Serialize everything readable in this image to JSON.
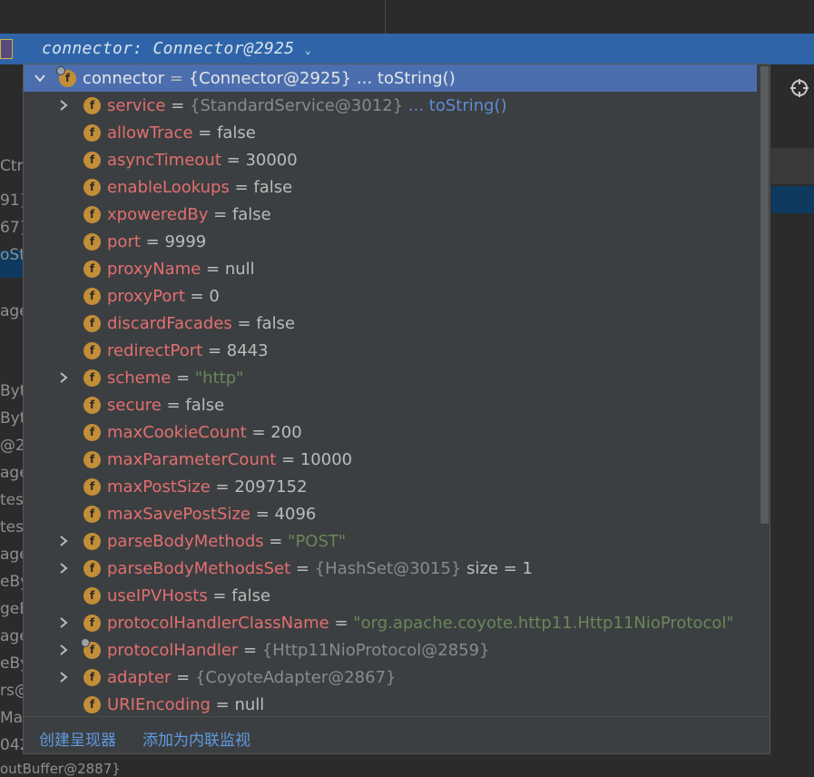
{
  "header": {
    "inline_hint": "connector: Connector@2925",
    "dropdown_icon": "chevron-down-icon"
  },
  "background": {
    "left_fragments": [
      "Ctr",
      "91}",
      "67}",
      "oSt",
      "age",
      "Byte",
      "Byte",
      "@2",
      "age",
      "tes",
      "tes(",
      "age",
      "eBy",
      "geB",
      "age",
      "eBy",
      "rs@",
      "Ma",
      "042"
    ],
    "bottom_fragment": "outBuffer@2887}",
    "target_icon": "crosshair-icon"
  },
  "popup": {
    "root": {
      "name": "connector",
      "value": "{Connector@2925}",
      "tostring": "... toString()"
    },
    "rows": [
      {
        "name": "service",
        "value": "{StandardService@3012}",
        "kind": "obj",
        "expandable": true,
        "tostring": "... toString()"
      },
      {
        "name": "allowTrace",
        "value": "false",
        "kind": "plain",
        "expandable": false
      },
      {
        "name": "asyncTimeout",
        "value": "30000",
        "kind": "plain",
        "expandable": false
      },
      {
        "name": "enableLookups",
        "value": "false",
        "kind": "plain",
        "expandable": false
      },
      {
        "name": "xpoweredBy",
        "value": "false",
        "kind": "plain",
        "expandable": false
      },
      {
        "name": "port",
        "value": "9999",
        "kind": "plain",
        "expandable": false
      },
      {
        "name": "proxyName",
        "value": "null",
        "kind": "plain",
        "expandable": false
      },
      {
        "name": "proxyPort",
        "value": "0",
        "kind": "plain",
        "expandable": false
      },
      {
        "name": "discardFacades",
        "value": "false",
        "kind": "plain",
        "expandable": false
      },
      {
        "name": "redirectPort",
        "value": "8443",
        "kind": "plain",
        "expandable": false
      },
      {
        "name": "scheme",
        "value": "\"http\"",
        "kind": "str",
        "expandable": true
      },
      {
        "name": "secure",
        "value": "false",
        "kind": "plain",
        "expandable": false
      },
      {
        "name": "maxCookieCount",
        "value": "200",
        "kind": "plain",
        "expandable": false
      },
      {
        "name": "maxParameterCount",
        "value": "10000",
        "kind": "plain",
        "expandable": false
      },
      {
        "name": "maxPostSize",
        "value": "2097152",
        "kind": "plain",
        "expandable": false
      },
      {
        "name": "maxSavePostSize",
        "value": "4096",
        "kind": "plain",
        "expandable": false
      },
      {
        "name": "parseBodyMethods",
        "value": "\"POST\"",
        "kind": "str",
        "expandable": true
      },
      {
        "name": "parseBodyMethodsSet",
        "value": "{HashSet@3015}",
        "kind": "obj",
        "expandable": true,
        "extra": " size = 1"
      },
      {
        "name": "useIPVHosts",
        "value": "false",
        "kind": "plain",
        "expandable": false
      },
      {
        "name": "protocolHandlerClassName",
        "value": "\"org.apache.coyote.http11.Http11NioProtocol\"",
        "kind": "str",
        "expandable": true
      },
      {
        "name": "protocolHandler",
        "value": "{Http11NioProtocol@2859}",
        "kind": "obj",
        "expandable": true,
        "badge": true
      },
      {
        "name": "adapter",
        "value": "{CoyoteAdapter@2867}",
        "kind": "obj",
        "expandable": true
      },
      {
        "name": "URIEncoding",
        "value": "null",
        "kind": "plain",
        "expandable": false
      }
    ],
    "footer": {
      "create_renderer": "创建呈现器",
      "add_inline_watch": "添加为内联监视"
    },
    "field_icon_letter": "f"
  },
  "colors": {
    "selection": "#4b6eaf",
    "field_name": "#e26f6f",
    "string_value": "#6a8759",
    "link": "#5f9ae0"
  }
}
